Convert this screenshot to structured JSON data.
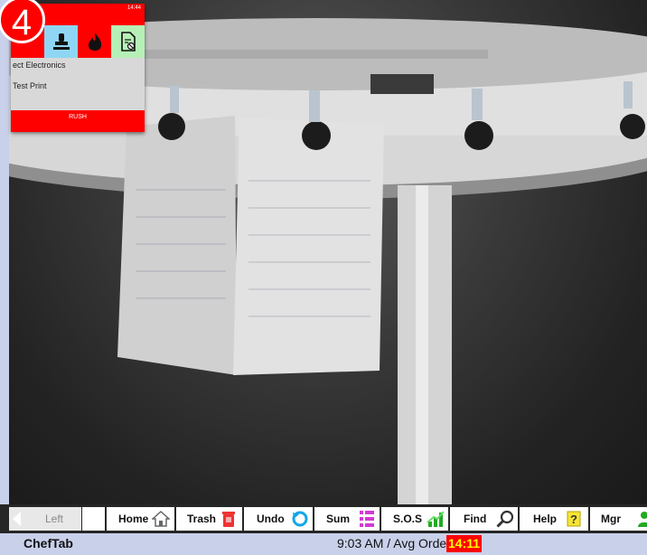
{
  "ticket": {
    "number": "4",
    "time": "14:44",
    "lines": [
      "ect Electronics",
      "Test Print"
    ],
    "footer": "RUSH",
    "buttons": [
      "flag",
      "stamp",
      "fire",
      "document-x"
    ]
  },
  "toolbar": {
    "buttons": [
      {
        "label": "Left",
        "icon": "triangle-left-icon"
      },
      {
        "label": "Home",
        "icon": "home-icon"
      },
      {
        "label": "Trash",
        "icon": "trash-icon"
      },
      {
        "label": "Undo",
        "icon": "undo-icon"
      },
      {
        "label": "Sum",
        "icon": "list-icon"
      },
      {
        "label": "S.O.S",
        "icon": "bars-icon"
      },
      {
        "label": "Find",
        "icon": "magnifier-icon"
      },
      {
        "label": "Help",
        "icon": "help-icon"
      },
      {
        "label": "Mgr",
        "icon": "manager-icon"
      }
    ]
  },
  "status": {
    "app_name": "ChefTab",
    "time_text": "9:03 AM / Avg Order",
    "avg_order": "14:11"
  },
  "colors": {
    "accent_red": "#ff0000",
    "status_bg": "#c9d0ea",
    "toolbar_bg": "#262626"
  }
}
